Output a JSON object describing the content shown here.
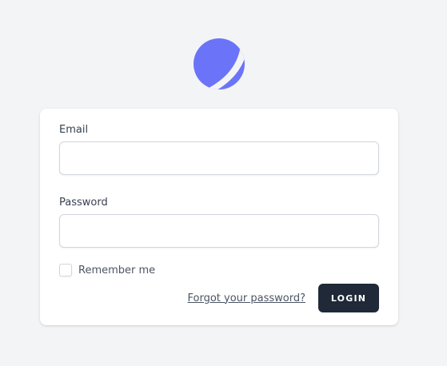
{
  "logo": {
    "icon": "planet-logo-icon",
    "color": "#6b74f8"
  },
  "form": {
    "email_label": "Email",
    "email_value": "",
    "password_label": "Password",
    "password_value": "",
    "remember_label": "Remember me",
    "remember_checked": false,
    "forgot_label": "Forgot your password?",
    "login_label": "LOGIN"
  },
  "colors": {
    "background": "#f3f4f6",
    "card": "#ffffff",
    "button": "#1f2937"
  }
}
